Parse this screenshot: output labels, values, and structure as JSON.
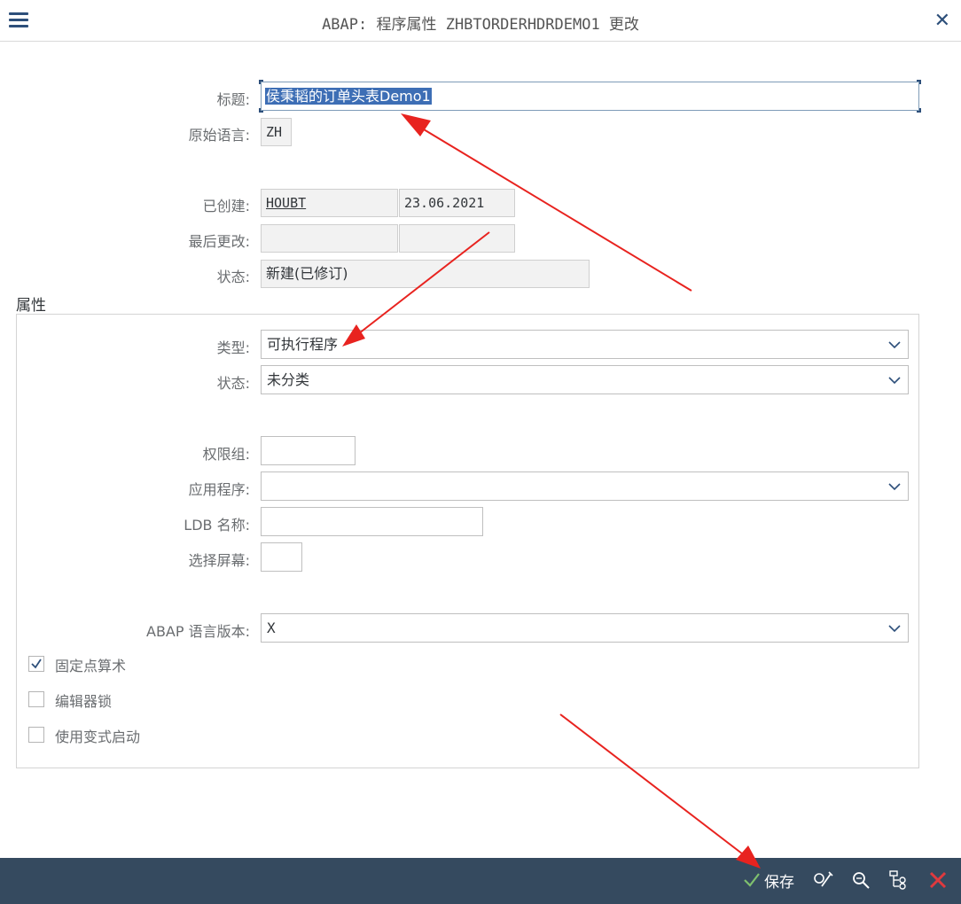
{
  "window": {
    "title": "ABAP: 程序属性 ZHBTORDERHDRDEMO1 更改"
  },
  "form": {
    "title_label": "标题:",
    "title_value": "侯秉韬的订单头表Demo1",
    "orig_lang_label": "原始语言:",
    "orig_lang_value": "ZH",
    "created_label": "已创建:",
    "created_user": "HOUBT",
    "created_date": "23.06.2021",
    "last_changed_label": "最后更改:",
    "last_changed_user": "",
    "last_changed_date": "",
    "status_label": "状态:",
    "status_value": "新建(已修订)"
  },
  "attributes": {
    "group_title": "属性",
    "type_label": "类型:",
    "type_value": "可执行程序",
    "status_label": "状态:",
    "status_value": "未分类",
    "auth_group_label": "权限组:",
    "auth_group_value": "",
    "application_label": "应用程序:",
    "application_value": "",
    "ldb_label": "LDB 名称:",
    "ldb_value": "",
    "selection_screen_label": "选择屏幕:",
    "selection_screen_value": "",
    "abap_version_label": "ABAP 语言版本:",
    "abap_version_value": "X",
    "checkboxes": [
      {
        "label": "固定点算术",
        "checked": true
      },
      {
        "label": "编辑器锁",
        "checked": false
      },
      {
        "label": "使用变式启动",
        "checked": false
      }
    ]
  },
  "footer": {
    "save_label": "保存",
    "icons": [
      "check-icon",
      "edit-icon",
      "zoom-icon",
      "hierarchy-icon",
      "cancel-icon"
    ]
  },
  "colors": {
    "footer_bg": "#354a5f",
    "accent": "#2d4f7a",
    "selection": "#3d6eb5",
    "annotation_arrow": "#e8231f",
    "save_check": "#7fc06e",
    "cancel_red": "#e0393e"
  }
}
